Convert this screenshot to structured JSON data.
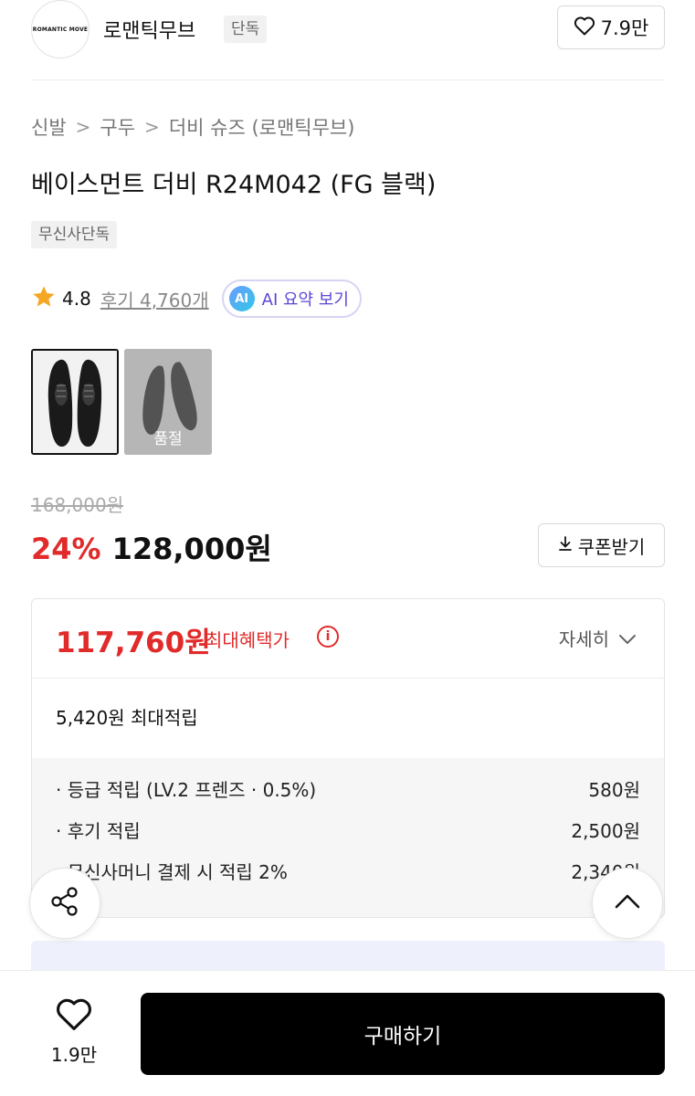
{
  "brand": {
    "logo_text": "ROMANTIC MOVE",
    "name": "로맨틱무브",
    "badge": "단독",
    "like_count": "7.9만",
    "like_icon": "heart-icon"
  },
  "breadcrumb": {
    "items": [
      "신발",
      "구두",
      "더비 슈즈 (로맨틱무브)"
    ],
    "separator": ">"
  },
  "product": {
    "title": "베이스먼트 더비 R24M042 (FG 블랙)",
    "badge": "무신사단독",
    "rating": "4.8",
    "rating_icon": "star-icon",
    "review_link": "후기 4,760개",
    "ai_summary": {
      "icon_text": "AI",
      "label": "AI 요약 보기"
    }
  },
  "thumbnails": {
    "soldout_label": "품절"
  },
  "price": {
    "original": "168,000원",
    "discount": "24%",
    "sale": "128,000원",
    "coupon_label": "쿠폰받기",
    "coupon_icon": "download-icon"
  },
  "benefit": {
    "max_price": "117,760원",
    "max_label": "최대혜택가",
    "info_icon_text": "i",
    "detail_label": "자세히",
    "point_total": "5,420원 최대적립",
    "points": [
      {
        "label": "· 등급 적립 (LV.2 프렌즈 · 0.5%)",
        "value": "580원"
      },
      {
        "label": "· 후기 적립",
        "value": "2,500원"
      },
      {
        "label": "· 무신사머니 결제 시 적립 2%",
        "value": "2,340원"
      }
    ]
  },
  "bottom_bar": {
    "like_count": "1.9만",
    "buy_label": "구매하기"
  },
  "colors": {
    "accent_red": "#e12b2b",
    "ai_purple": "#5a47d6",
    "buy_button": "#000000"
  }
}
